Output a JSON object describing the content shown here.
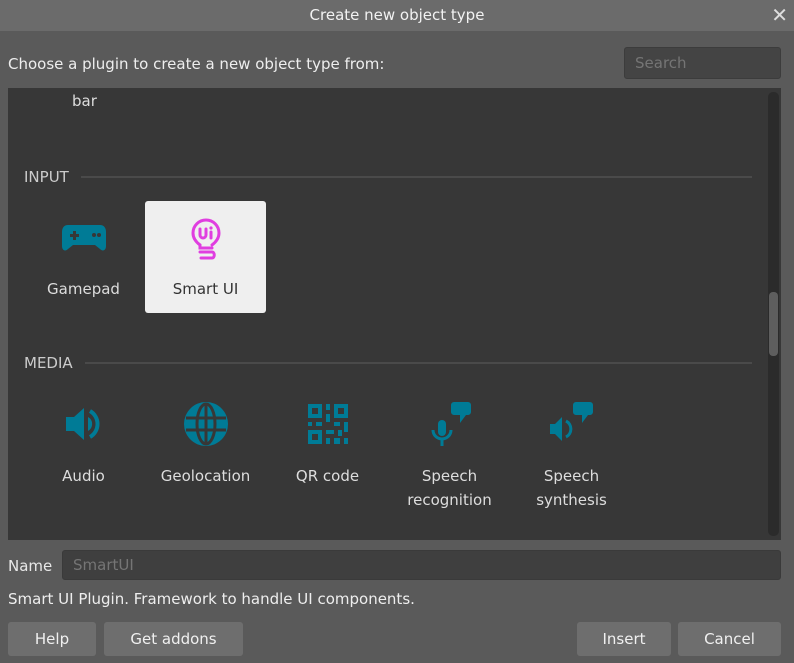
{
  "title": "Create new object type",
  "prompt": "Choose a plugin to create a new object type from:",
  "search": {
    "placeholder": "Search",
    "value": ""
  },
  "cut_item_label": "bar",
  "sections": [
    {
      "label": "INPUT",
      "items": [
        {
          "label": "Gamepad",
          "icon": "gamepad-icon"
        },
        {
          "label": "Smart UI",
          "icon": "smart-ui-bulb-icon",
          "selected": true
        }
      ]
    },
    {
      "label": "MEDIA",
      "items": [
        {
          "label": "Audio",
          "icon": "speaker-icon"
        },
        {
          "label": "Geolocation",
          "icon": "globe-icon"
        },
        {
          "label": "QR code",
          "icon": "qr-code-icon"
        },
        {
          "label": "Speech recognition",
          "icon": "microphone-speech-icon"
        },
        {
          "label": "Speech synthesis",
          "icon": "speaker-speech-icon"
        }
      ]
    }
  ],
  "name": {
    "label": "Name",
    "placeholder": "SmartUI"
  },
  "description": "Smart UI Plugin. Framework to handle UI components.",
  "buttons": {
    "help": "Help",
    "addons": "Get addons",
    "insert": "Insert",
    "cancel": "Cancel"
  },
  "colors": {
    "icon": "#007b96",
    "selected_icon": "#e03ee0",
    "selected_bg": "#efefef"
  }
}
